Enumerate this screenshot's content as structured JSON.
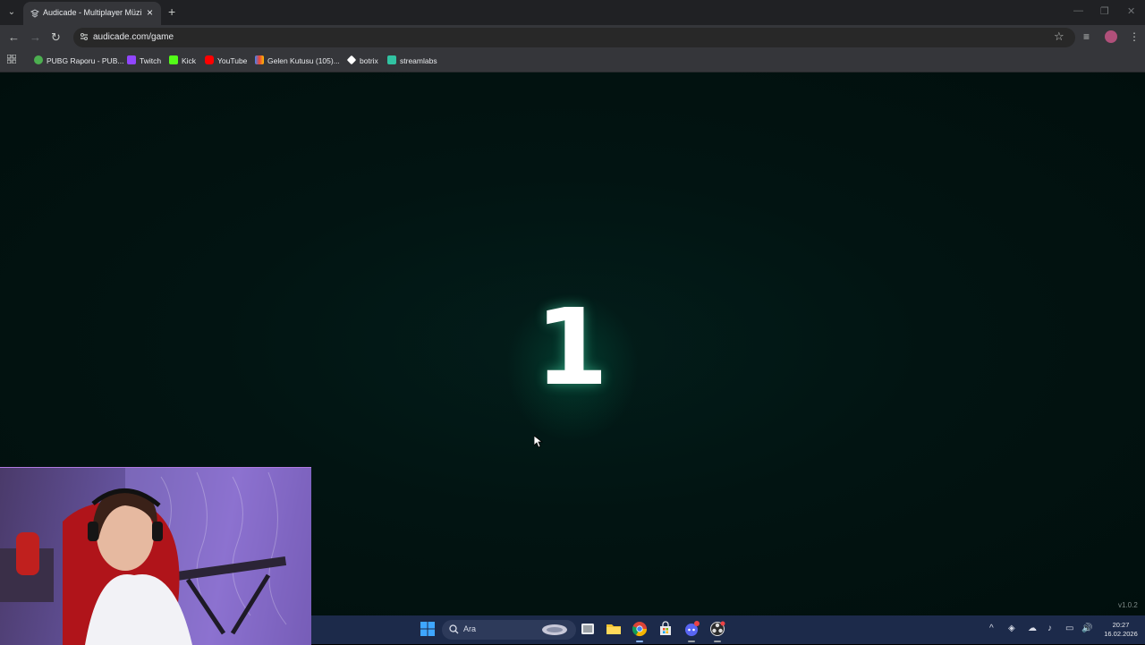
{
  "browser": {
    "tab": {
      "title": "Audicade - Multiplayer Müzik T"
    },
    "url": "audicade.com/game",
    "bookmarks": [
      {
        "label": "PUBG Raporu - PUB...",
        "icon": "pubg-report-icon",
        "color": "#4caf50"
      },
      {
        "label": "Twitch",
        "icon": "twitch-icon",
        "color": "#9146ff"
      },
      {
        "label": "Kick",
        "icon": "kick-icon",
        "color": "#53fc18"
      },
      {
        "label": "YouTube",
        "icon": "youtube-icon",
        "color": "#ff0000"
      },
      {
        "label": "Gelen Kutusu (105)...",
        "icon": "gmail-icon",
        "color": "#ea4335"
      },
      {
        "label": "botrix",
        "icon": "botrix-icon",
        "color": "#ffffff"
      },
      {
        "label": "streamlabs",
        "icon": "streamlabs-icon",
        "color": "#31c3a2"
      }
    ]
  },
  "game": {
    "countdown": "1",
    "version": "v1.0.2"
  },
  "taskbar": {
    "search_placeholder": "Ara",
    "time": "20:27",
    "date": "16.02.2026"
  }
}
